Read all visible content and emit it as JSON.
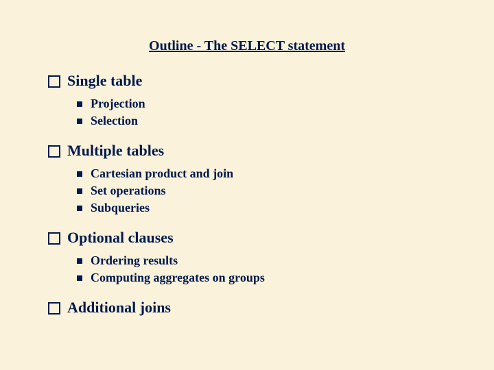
{
  "title": "Outline - The SELECT statement",
  "sections": [
    {
      "label": "Single table",
      "items": [
        "Projection",
        "Selection"
      ]
    },
    {
      "label": "Multiple tables",
      "items": [
        "Cartesian product and join",
        "Set operations",
        "Subqueries"
      ]
    },
    {
      "label": "Optional clauses",
      "items": [
        "Ordering results",
        "Computing aggregates on groups"
      ]
    },
    {
      "label": "Additional joins",
      "items": []
    }
  ]
}
